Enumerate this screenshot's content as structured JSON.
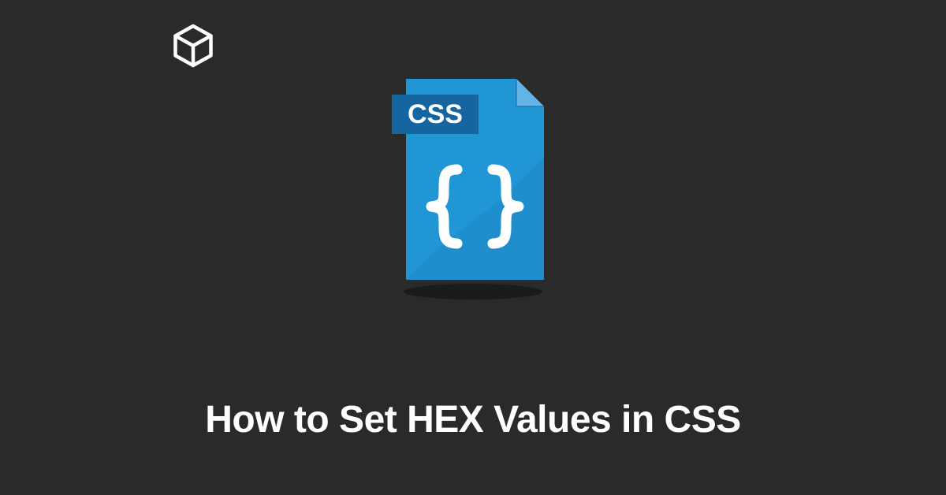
{
  "title": "How to Set HEX Values in CSS",
  "file_badge_label": "CSS",
  "colors": {
    "background": "#2a2a2a",
    "text": "#ffffff",
    "file_primary": "#2196d4",
    "file_secondary": "#1976b8",
    "badge_bg": "#1565a0",
    "fold": "#64b5e6"
  }
}
